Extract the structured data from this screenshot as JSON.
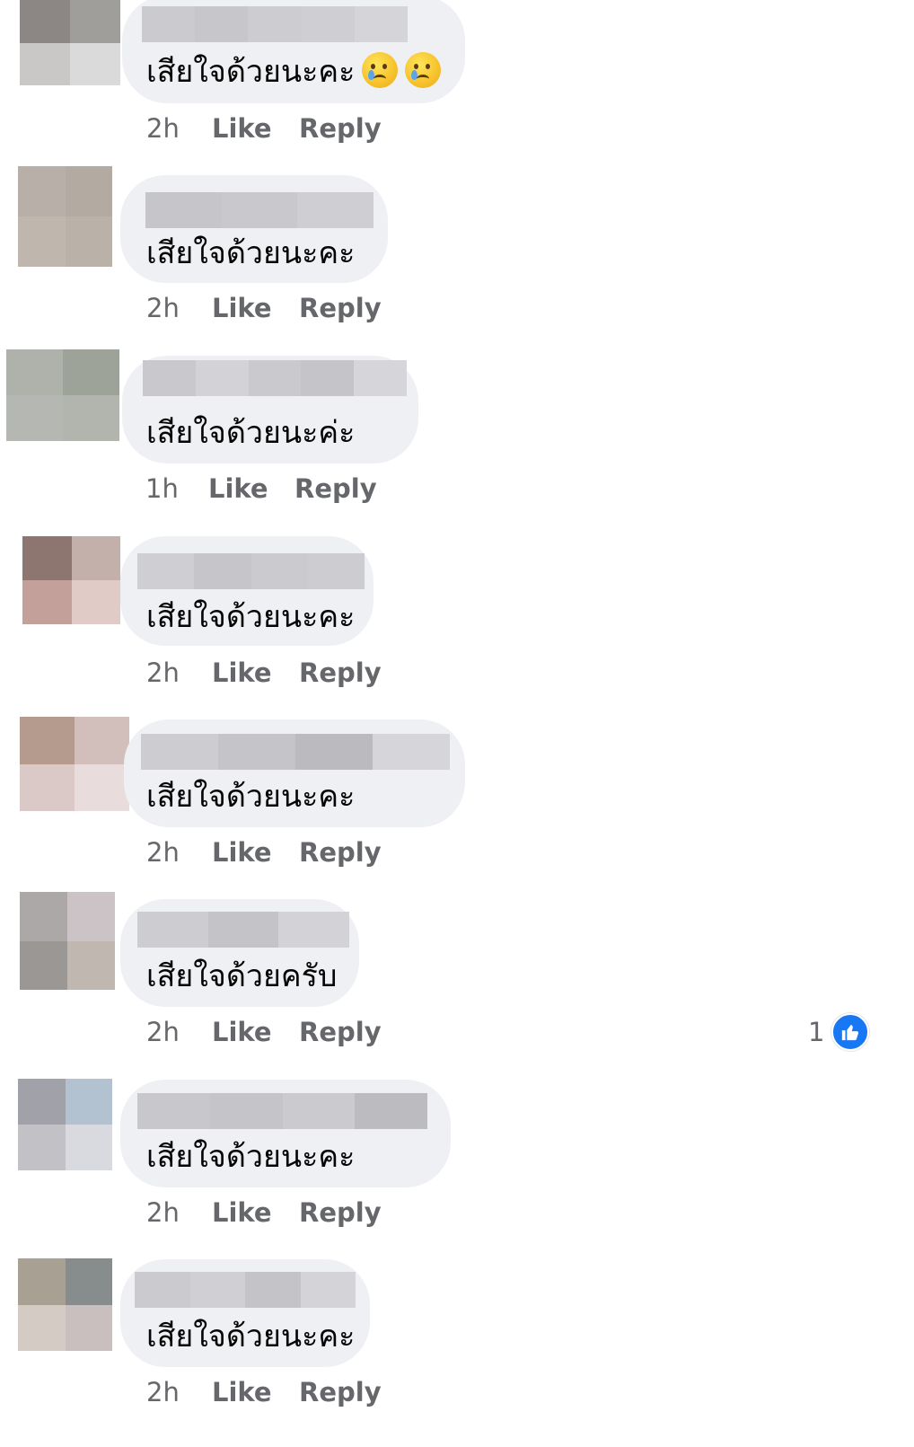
{
  "comments": [
    {
      "text": "เสียใจด้วยนะคะ",
      "emojis": [
        "crying-face",
        "crying-face"
      ],
      "time": "2h",
      "like": "Like",
      "reply": "Reply",
      "avatar_colors": [
        "#8c8784",
        "#a09e9b",
        "#c9c8c6",
        "#dbdada"
      ],
      "name_blur_colors": [
        "#cbcbcf",
        "#c7c7cb",
        "#cdcdd1",
        "#cfcfd3",
        "#d5d5d9"
      ]
    },
    {
      "text": "เสียใจด้วยนะคะ",
      "emojis": [],
      "time": "2h",
      "like": "Like",
      "reply": "Reply",
      "avatar_colors": [
        "#b8afa8",
        "#b3aaa2",
        "#bfb6ad",
        "#bab1a8"
      ],
      "name_blur_colors": [
        "#c6c6ca",
        "#c9c9cd",
        "#cfcfd3"
      ]
    },
    {
      "text": "เสียใจด้วยนะค่ะ",
      "emojis": [],
      "time": "1h",
      "like": "Like",
      "reply": "Reply",
      "avatar_colors": [
        "#aeb2ab",
        "#9ea39a",
        "#b5b8b2",
        "#b1b5ae"
      ],
      "name_blur_colors": [
        "#c9c9cd",
        "#d3d3d7",
        "#cacace",
        "#c5c5c9",
        "#d6d6da"
      ]
    },
    {
      "text": "เสียใจด้วยนะคะ",
      "emojis": [],
      "time": "2h",
      "like": "Like",
      "reply": "Reply",
      "avatar_colors": [
        "#8c766f",
        "#c4b0aa",
        "#c3a099",
        "#e1cbc6"
      ],
      "name_blur_colors": [
        "#cfcfd3",
        "#c6c6ca",
        "#cbcbcf",
        "#cdcdd1"
      ]
    },
    {
      "text": "เสียใจด้วยนะคะ",
      "emojis": [],
      "time": "2h",
      "like": "Like",
      "reply": "Reply",
      "avatar_colors": [
        "#b59a8e",
        "#d2bfbc",
        "#dbc9c8",
        "#e8dddc"
      ],
      "name_blur_colors": [
        "#cdcdd1",
        "#c5c5c9",
        "#bbbbbf",
        "#d6d6da"
      ]
    },
    {
      "text": "เสียใจด้วยครับ",
      "emojis": [],
      "time": "2h",
      "like": "Like",
      "reply": "Reply",
      "avatar_colors": [
        "#aca8a8",
        "#cbc3c5",
        "#9a9795",
        "#c1b7b1"
      ],
      "name_blur_colors": [
        "#cdcdd1",
        "#c4c4c8",
        "#d3d3d7"
      ],
      "reactions": {
        "count": "1",
        "icon": "thumbs-up-icon",
        "color": "#1877f2"
      }
    },
    {
      "text": "เสียใจด้วยนะคะ",
      "emojis": [],
      "time": "2h",
      "like": "Like",
      "reply": "Reply",
      "avatar_colors": [
        "#a1a2a9",
        "#b2c2d0",
        "#c2c2c6",
        "#d9dadf"
      ],
      "name_blur_colors": [
        "#c8c8cc",
        "#c5c5c9",
        "#cbcbcf",
        "#bcbcc0"
      ]
    },
    {
      "text": "เสียใจด้วยนะคะ",
      "emojis": [],
      "time": "2h",
      "like": "Like",
      "reply": "Reply",
      "avatar_colors": [
        "#a8a193",
        "#878c8d",
        "#d3cbc4",
        "#cabfbf"
      ],
      "name_blur_colors": [
        "#cbcbcf",
        "#d0d0d4",
        "#c4c4c8",
        "#d4d4d8"
      ]
    }
  ],
  "colors": {
    "bubble": "#eff0f3",
    "meta_text": "#65676b",
    "body_text": "#050505",
    "accent": "#1877f2"
  }
}
